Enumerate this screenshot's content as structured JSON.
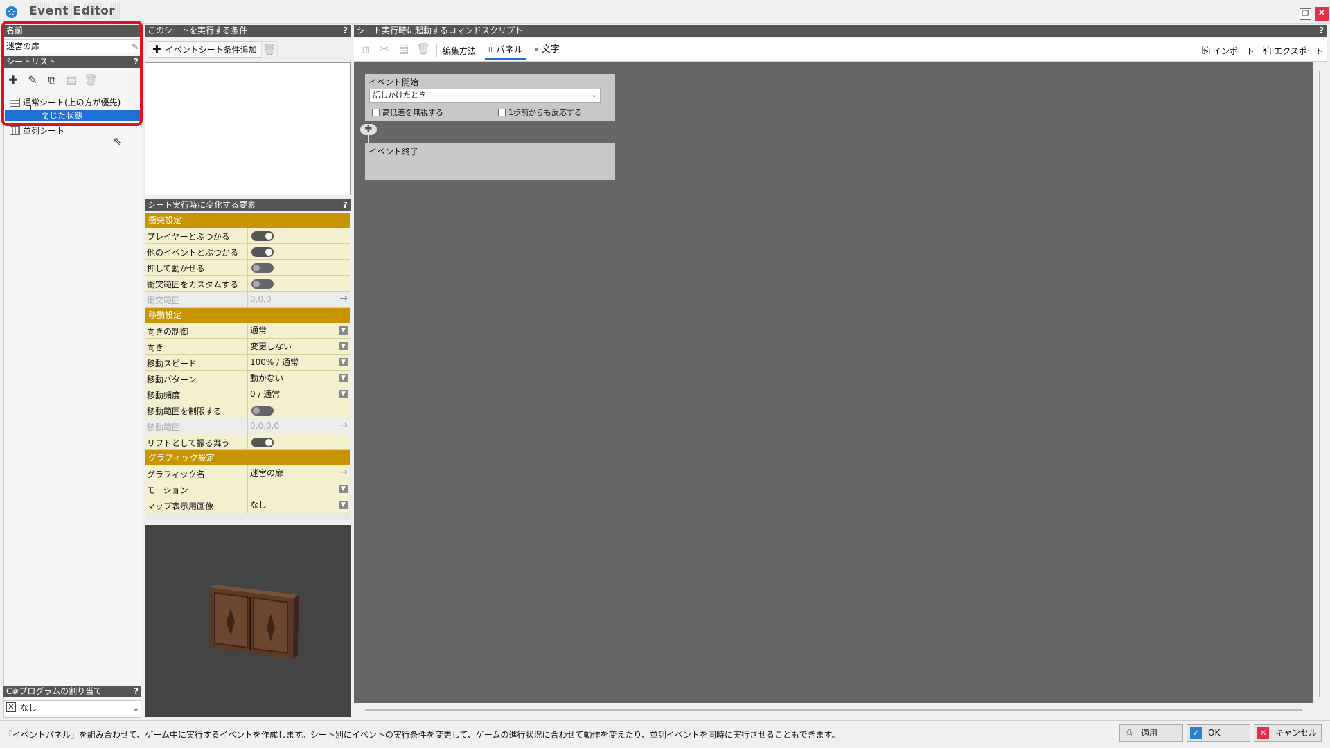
{
  "window": {
    "title": "Event Editor",
    "restore_icon": "restore-icon",
    "close_icon": "close-icon"
  },
  "left": {
    "name_header": "名前",
    "name_value": "迷宮の扉",
    "sheetlist_header": "シートリスト",
    "help": "?",
    "tree": [
      {
        "label": "通常シート(上の方が優先)",
        "icon": "sheet-icon"
      },
      {
        "label": "閉じた状態",
        "selected": true
      },
      {
        "label": "並列シート",
        "icon": "parallel-icon"
      }
    ],
    "csharp_header": "C#プログラムの割り当て",
    "csharp_value": "なし"
  },
  "conditions": {
    "header": "このシートを実行する条件",
    "add_button": "イベントシート条件追加"
  },
  "props": {
    "header": "シート実行時に変化する要素",
    "sections": {
      "collision": "衝突設定",
      "movement": "移動設定",
      "graphic": "グラフィック設定"
    },
    "rows": {
      "player_hit": "プレイヤーとぶつかる",
      "event_hit": "他のイベントとぶつかる",
      "pushable": "押して動かせる",
      "custom_range": "衝突範囲をカスタムする",
      "hit_range": "衝突範囲",
      "hit_range_value": "0,0,0",
      "dir_control": "向きの制御",
      "dir_control_value": "通常",
      "direction": "向き",
      "direction_value": "変更しない",
      "speed": "移動スピード",
      "speed_value": "100% / 通常",
      "pattern": "移動パターン",
      "pattern_value": "動かない",
      "frequency": "移動頻度",
      "frequency_value": "0 / 通常",
      "limit_range": "移動範囲を制限する",
      "move_range": "移動範囲",
      "move_range_value": "0,0,0,0",
      "lift": "リフトとして振る舞う",
      "graphic_name": "グラフィック名",
      "graphic_name_value": "迷宮の扉",
      "motion": "モーション",
      "motion_value": "",
      "map_image": "マップ表示用画像",
      "map_image_value": "なし"
    },
    "toggles": {
      "player_hit": true,
      "event_hit": true,
      "pushable": false,
      "custom_range": false,
      "limit_range": false,
      "lift": true
    }
  },
  "script": {
    "header": "シート実行時に起動するコマンドスクリプト",
    "edit_method": "編集方法",
    "panel_label": "パネル",
    "text_label": "文字",
    "import_label": "インポート",
    "export_label": "エクスポート",
    "event_start": "イベント開始",
    "trigger_value": "話しかけたとき",
    "ignore_height": "高低差を無視する",
    "one_step": "1歩前からも反応する",
    "event_end": "イベント終了"
  },
  "status": {
    "message": "「イベントパネル」を組み合わせて、ゲーム中に実行するイベントを作成します。シート別にイベントの実行条件を変更して、ゲームの進行状況に合わせて動作を変えたり、並列イベントを同時に実行させることもできます。",
    "apply": "適用",
    "ok": "OK",
    "cancel": "キャンセル"
  },
  "colors": {
    "accent_red": "#e1101c",
    "section_gold": "#c89500",
    "selection_blue": "#1e6fd6",
    "canvas_gray": "#666666"
  }
}
